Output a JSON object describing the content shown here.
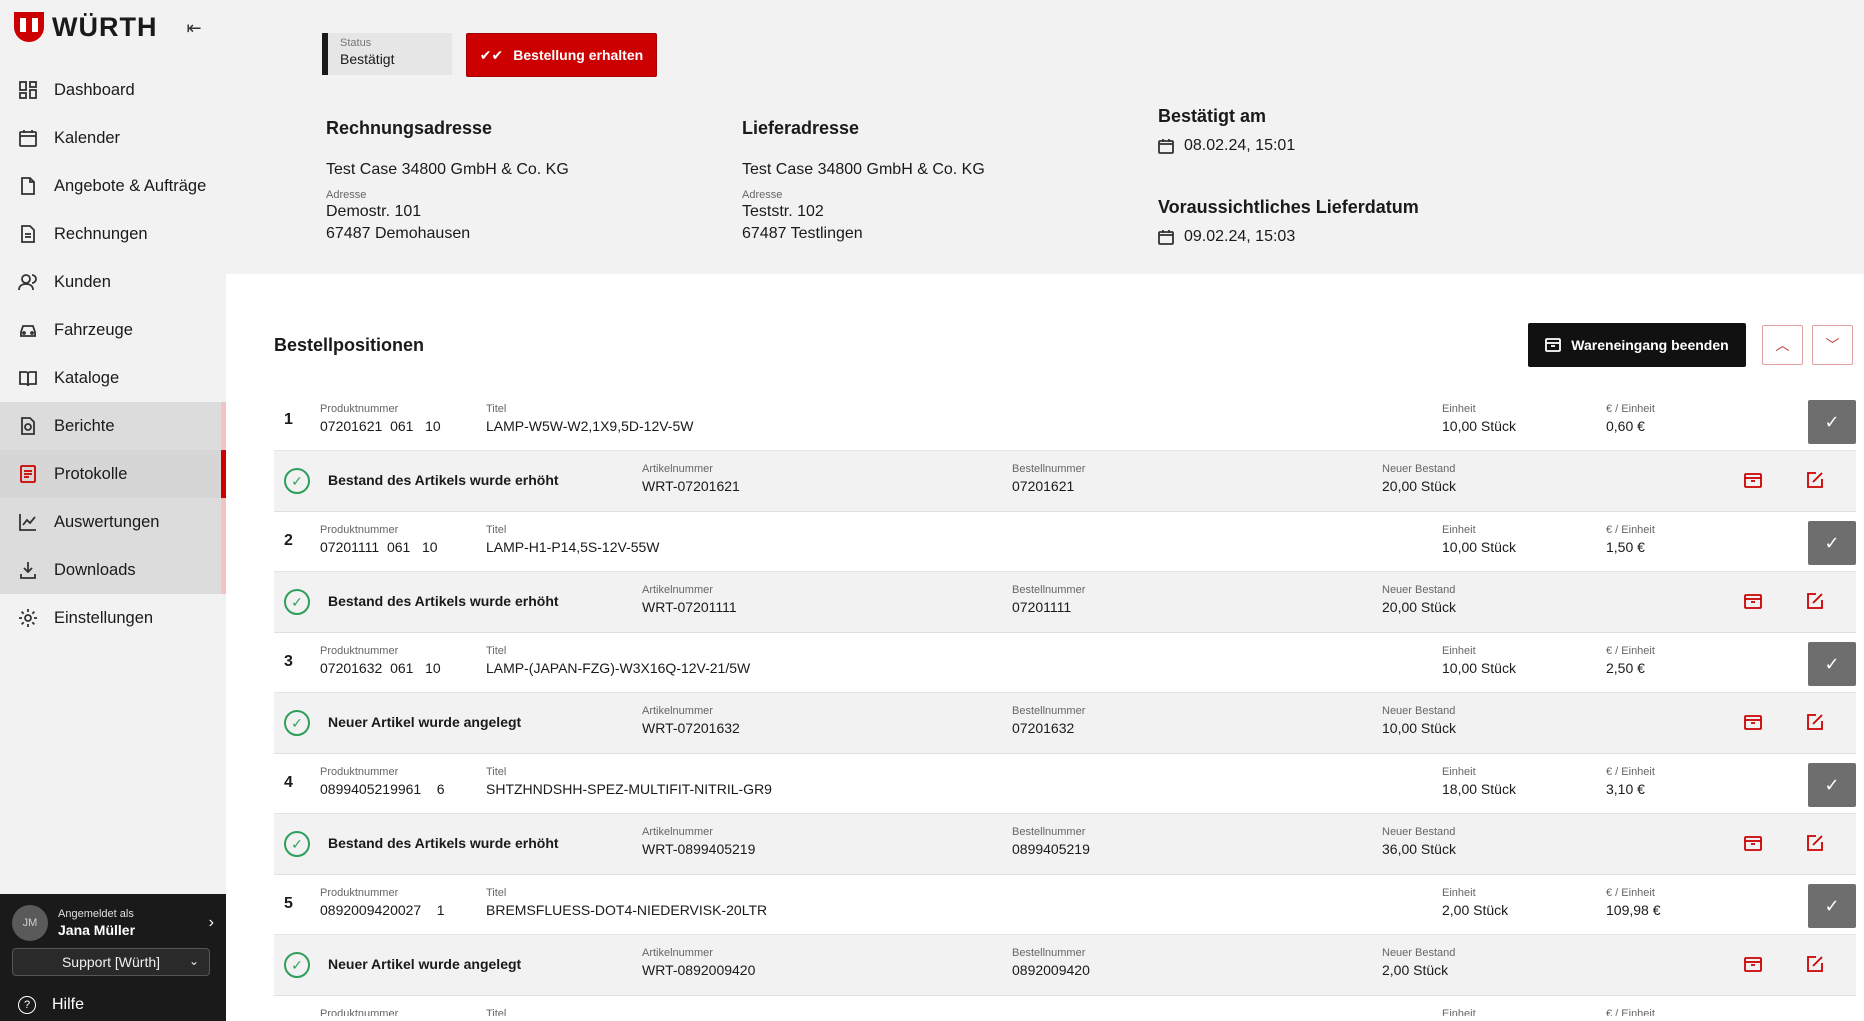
{
  "brand": {
    "logo_text": "WÜRTH",
    "accent": "#cc0000"
  },
  "sidebar": {
    "items": [
      {
        "label": "Dashboard",
        "icon": "dashboard-icon"
      },
      {
        "label": "Kalender",
        "icon": "calendar-icon"
      },
      {
        "label": "Angebote & Aufträge",
        "icon": "document-icon"
      },
      {
        "label": "Rechnungen",
        "icon": "invoice-icon"
      },
      {
        "label": "Kunden",
        "icon": "users-icon"
      },
      {
        "label": "Fahrzeuge",
        "icon": "car-icon"
      },
      {
        "label": "Kataloge",
        "icon": "book-icon"
      },
      {
        "label": "Berichte",
        "icon": "report-icon"
      },
      {
        "label": "Protokolle",
        "icon": "protocol-icon"
      },
      {
        "label": "Auswertungen",
        "icon": "chart-icon"
      },
      {
        "label": "Downloads",
        "icon": "download-icon"
      },
      {
        "label": "Einstellungen",
        "icon": "gear-icon"
      }
    ],
    "active": "Protokolle"
  },
  "user": {
    "initials": "JM",
    "caption": "Angemeldet als",
    "name": "Jana Müller",
    "role": "Support [Würth]",
    "help": "Hilfe"
  },
  "order": {
    "status_caption": "Status",
    "status_value": "Bestätigt",
    "receive_button": "Bestellung erhalten",
    "billing": {
      "title": "Rechnungsadresse",
      "company": "Test Case 34800 GmbH & Co. KG",
      "caption": "Adresse",
      "street": "Demostr. 101",
      "city": "67487 Demohausen"
    },
    "shipping": {
      "title": "Lieferadresse",
      "company": "Test Case 34800 GmbH & Co. KG",
      "caption": "Adresse",
      "street": "Teststr. 102",
      "city": "67487 Testlingen"
    },
    "confirmed_title": "Bestätigt am",
    "confirmed_value": "08.02.24, 15:01",
    "delivery_title": "Voraussichtliches Lieferdatum",
    "delivery_value": "09.02.24, 15:03"
  },
  "positions_section": {
    "title": "Bestellpositionen",
    "finish_button": "Wareneingang beenden"
  },
  "captions": {
    "product": "Produktnummer",
    "title": "Titel",
    "unit": "Einheit",
    "price": "€ / Einheit",
    "article": "Artikelnummer",
    "order": "Bestellnummer",
    "stock": "Neuer Bestand"
  },
  "positions": [
    {
      "num": "1",
      "product": "07201621  061   10",
      "title": "LAMP-W5W-W2,1X9,5D-12V-5W",
      "unit": "10,00 Stück",
      "price": "0,60 €",
      "msg": "Bestand des Artikels wurde erhöht",
      "article": "WRT-07201621",
      "order": "07201621",
      "stock": "20,00 Stück"
    },
    {
      "num": "2",
      "product": "07201111  061   10",
      "title": "LAMP-H1-P14,5S-12V-55W",
      "unit": "10,00 Stück",
      "price": "1,50 €",
      "msg": "Bestand des Artikels wurde erhöht",
      "article": "WRT-07201111",
      "order": "07201111",
      "stock": "20,00 Stück"
    },
    {
      "num": "3",
      "product": "07201632  061   10",
      "title": "LAMP-(JAPAN-FZG)-W3X16Q-12V-21/5W",
      "unit": "10,00 Stück",
      "price": "2,50 €",
      "msg": "Neuer Artikel wurde angelegt",
      "article": "WRT-07201632",
      "order": "07201632",
      "stock": "10,00 Stück"
    },
    {
      "num": "4",
      "product": "0899405219961    6",
      "title": "SHTZHNDSHH-SPEZ-MULTIFIT-NITRIL-GR9",
      "unit": "18,00 Stück",
      "price": "3,10 €",
      "msg": "Bestand des Artikels wurde erhöht",
      "article": "WRT-0899405219",
      "order": "0899405219",
      "stock": "36,00 Stück"
    },
    {
      "num": "5",
      "product": "0892009420027    1",
      "title": "BREMSFLUESS-DOT4-NIEDERVISK-20LTR",
      "unit": "2,00 Stück",
      "price": "109,98 €",
      "msg": "Neuer Artikel wurde angelegt",
      "article": "WRT-0892009420",
      "order": "0892009420",
      "stock": "2,00 Stück"
    }
  ]
}
